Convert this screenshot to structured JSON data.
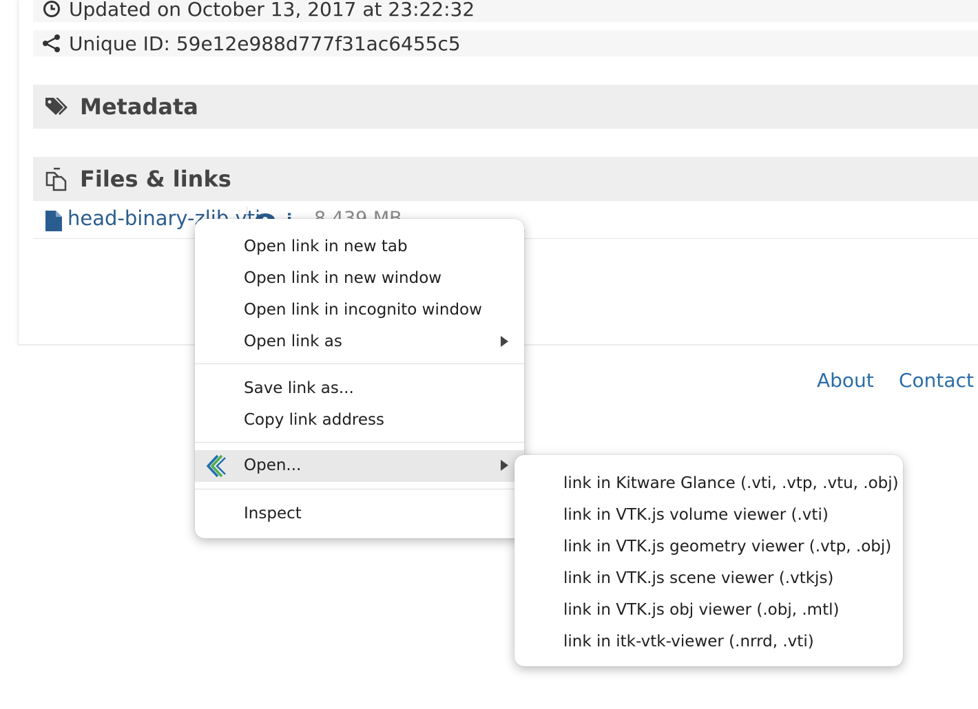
{
  "details": {
    "updated_text": "Updated on October 13, 2017 at 23:22:32",
    "unique_id_text": "Unique ID: 59e12e988d777f31ac6455c5"
  },
  "sections": {
    "metadata_title": "Metadata",
    "files_title": "Files & links"
  },
  "file": {
    "name": "head-binary-zlib.vti",
    "size": "8.439 MB"
  },
  "footer": {
    "about": "About",
    "contact": "Contact"
  },
  "context_menu": {
    "items": [
      "Open link in new tab",
      "Open link in new window",
      "Open link in incognito window",
      "Open link as",
      "Save link as...",
      "Copy link address",
      "Open...",
      "Inspect"
    ],
    "highlighted": "Open..."
  },
  "submenu": {
    "items": [
      "link in Kitware Glance (.vti, .vtp, .vtu, .obj)",
      "link in VTK.js volume viewer (.vti)",
      "link in VTK.js geometry viewer (.vtp, .obj)",
      "link in VTK.js scene viewer (.vtkjs)",
      "link in VTK.js obj viewer (.obj, .mtl)",
      "link in itk-vtk-viewer (.nrrd, .vti)"
    ]
  },
  "colors": {
    "link": "#2a6da6",
    "file_link": "#2a5d8f",
    "section_bg": "#eeeeee",
    "menu_highlight": "#e8e8e8"
  }
}
